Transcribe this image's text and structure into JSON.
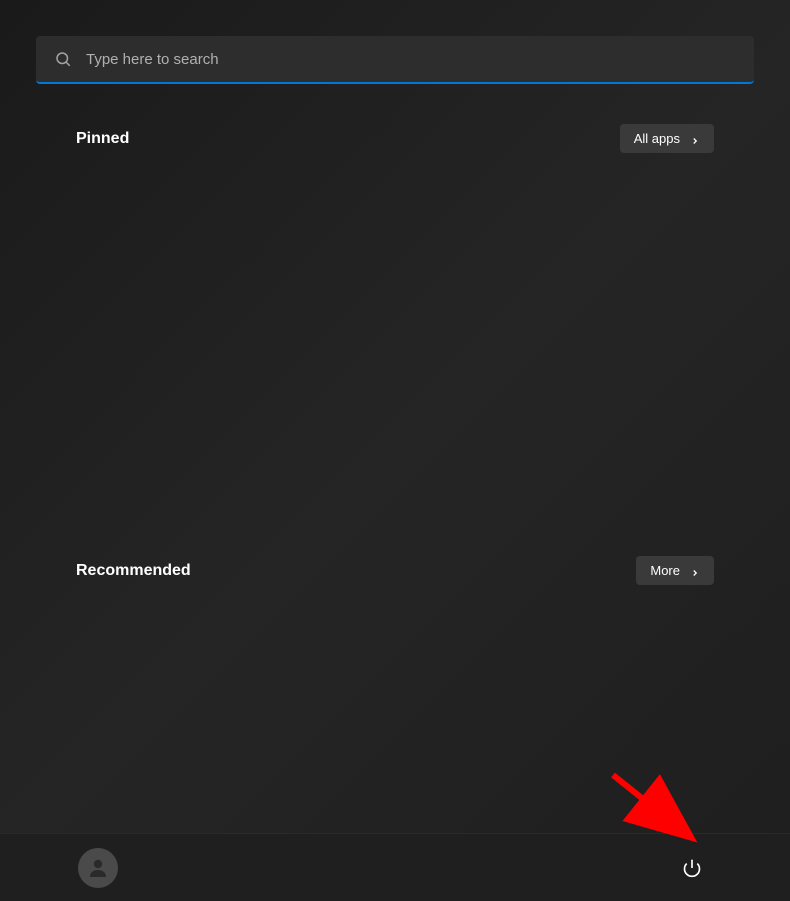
{
  "search": {
    "placeholder": "Type here to search"
  },
  "sections": {
    "pinned": {
      "title": "Pinned",
      "button_label": "All apps"
    },
    "recommended": {
      "title": "Recommended",
      "button_label": "More"
    }
  },
  "footer": {
    "user_icon": "user-icon",
    "power_icon": "power-icon"
  },
  "colors": {
    "accent": "#0078d4",
    "background": "#1a1a1a",
    "surface": "#2d2d2d",
    "button": "#3a3a3a",
    "footer": "#1f1f1f",
    "arrow": "#ff0000"
  }
}
